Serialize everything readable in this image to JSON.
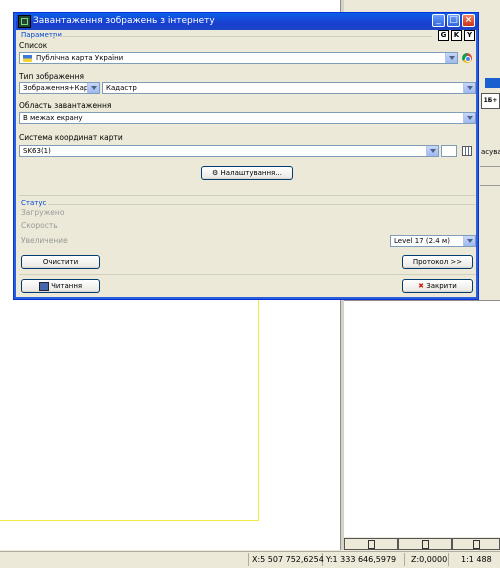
{
  "window": {
    "title": "Завантаження зображень з інтернету",
    "minimize_icon": "minimize-icon",
    "maximize_icon": "maximize-icon",
    "close_glyph": "×"
  },
  "provider_buttons": [
    "G",
    "K",
    "Y"
  ],
  "sections": {
    "parameters": "Параметри",
    "status": "Статус"
  },
  "fields": {
    "list_label": "Список",
    "list_value": "Публічна карта України",
    "image_type_label": "Тип зображення",
    "image_type_value": "Зображення+Карта",
    "image_type_sub_value": "Кадастр",
    "area_label": "Область завантаження",
    "area_value": "В межах екрану",
    "crs_label": "Система координат карти",
    "crs_value": "SK63(1)"
  },
  "buttons": {
    "settings": "Налаштування...",
    "clear": "Очистити",
    "protocol": "Протокол >>",
    "read": "Читання",
    "close": "Закрити"
  },
  "status": {
    "loaded_label": "Загружено",
    "speed_label": "Скорость",
    "zoom_label": "Увеличение",
    "level_value": "Level 17  (2.4 м)"
  },
  "status_bar": {
    "x": "X:5 507 752,6254",
    "y": "Y:1 333 646,5979",
    "z": "Z:0,0000",
    "scale": "1:1 488"
  },
  "side_panel": {
    "button": "1Б+",
    "text": "асував"
  },
  "colors": {
    "title_bar": "#1a3fd0",
    "group_header": "#0046d5",
    "background": "#ece9d8"
  }
}
